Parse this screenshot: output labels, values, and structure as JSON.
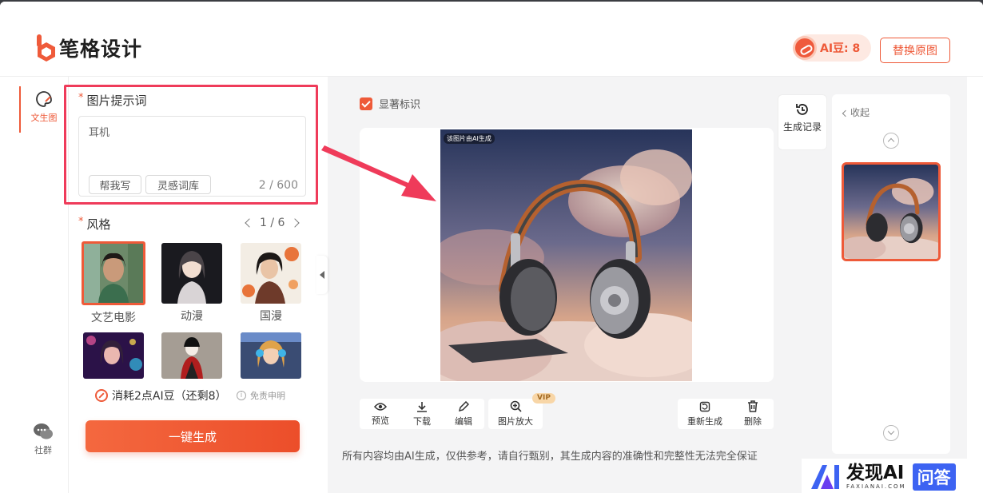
{
  "header": {
    "brand": "笔格设计",
    "ai_beans_label": "AI豆: 8",
    "replace_button": "替换原图"
  },
  "rail": {
    "active_label": "文生图",
    "community_label": "社群"
  },
  "prompt": {
    "title": "图片提示词",
    "value": "耳机",
    "help_button": "帮我写",
    "library_button": "灵感词库",
    "counter": "2 / 600"
  },
  "style": {
    "title": "风格",
    "page": "1 / 6",
    "items": [
      {
        "label": "文艺电影",
        "selected": true
      },
      {
        "label": "动漫",
        "selected": false
      },
      {
        "label": "国漫",
        "selected": false
      },
      {
        "label": "",
        "selected": false
      },
      {
        "label": "",
        "selected": false
      },
      {
        "label": "",
        "selected": false
      }
    ]
  },
  "cost": {
    "text": "消耗2点AI豆（还剩8）",
    "disclaimer": "免责申明"
  },
  "generate_button": "一键生成",
  "workspace": {
    "watermark_checkbox": "显著标识",
    "watermark_checked": true,
    "ai_badge": "该图片由AI生成",
    "history_button": "生成记录",
    "tools_left": [
      {
        "label": "预览",
        "icon": "eye-icon"
      },
      {
        "label": "下载",
        "icon": "download-icon"
      },
      {
        "label": "编辑",
        "icon": "pencil-icon"
      }
    ],
    "upscale_label": "图片放大",
    "vip_badge": "VIP",
    "tools_right": [
      {
        "label": "重新生成",
        "icon": "regenerate-icon"
      },
      {
        "label": "删除",
        "icon": "trash-icon"
      }
    ],
    "footer_note": "所有内容均由AI生成，仅供参考，请自行甄别，其生成内容的准确性和完整性无法完全保证"
  },
  "history_panel": {
    "collapse": "收起"
  },
  "site_watermark": {
    "name": "发现AI",
    "domain": "FAXIANAI.COM",
    "badge": "问答"
  },
  "colors": {
    "accent": "#ee5a39",
    "highlight_border": "#ef3b5a",
    "watermark_blue": "#3d63f2"
  }
}
